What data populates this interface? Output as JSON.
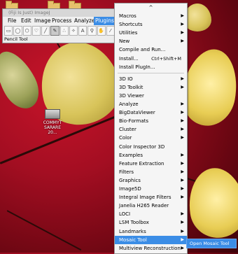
{
  "window": {
    "title": "(Fiji Is Just) ImageJ",
    "status": "Pencil Tool",
    "menubar": [
      "File",
      "Edit",
      "Image",
      "Process",
      "Analyze",
      "Plugins"
    ],
    "active_menu": "Plugins",
    "tool_icons": [
      "rectangle-icon",
      "oval-icon",
      "polygon-icon",
      "freehand-icon",
      "line-icon",
      "pencil-icon",
      "point-icon",
      "wand-icon",
      "text-icon",
      "magnifier-icon",
      "hand-icon",
      "dropper-icon",
      "more-icon"
    ]
  },
  "desktop_icon": {
    "label": "COMMYT SARARE 20..."
  },
  "plugins_menu": {
    "scroll_up": "^",
    "items": [
      {
        "label": "Macros",
        "arrow": true
      },
      {
        "label": "Shortcuts",
        "arrow": true
      },
      {
        "label": "Utilities",
        "arrow": true
      },
      {
        "label": "New",
        "arrow": true
      },
      {
        "label": "Compile and Run...",
        "arrow": false
      },
      {
        "label": "Install...",
        "shortcut": "Ctrl+Shift+M"
      },
      {
        "label": "Install PlugIn...",
        "arrow": false
      },
      {
        "sep": true
      },
      {
        "label": "3D IO",
        "arrow": true
      },
      {
        "label": "3D Toolkit",
        "arrow": true
      },
      {
        "label": "3D Viewer",
        "arrow": false
      },
      {
        "label": "Analyze",
        "arrow": true
      },
      {
        "label": "BigDataViewer",
        "arrow": true
      },
      {
        "label": "Bio-Formats",
        "arrow": true
      },
      {
        "label": "Cluster",
        "arrow": true
      },
      {
        "label": "Color",
        "arrow": true
      },
      {
        "label": "Color Inspector 3D",
        "arrow": false
      },
      {
        "label": "Examples",
        "arrow": true
      },
      {
        "label": "Feature Extraction",
        "arrow": true
      },
      {
        "label": "Filters",
        "arrow": true
      },
      {
        "label": "Graphics",
        "arrow": true
      },
      {
        "label": "Image5D",
        "arrow": true
      },
      {
        "label": "Integral Image Filters",
        "arrow": true
      },
      {
        "label": "Janelia H265 Reader",
        "arrow": false
      },
      {
        "label": "LOCI",
        "arrow": true
      },
      {
        "label": "LSM Toolbox",
        "arrow": true
      },
      {
        "label": "Landmarks",
        "arrow": true
      },
      {
        "label": "Mosaic Tool",
        "arrow": true,
        "highlight": true
      },
      {
        "label": "Multiview Reconstruction",
        "arrow": true
      }
    ]
  },
  "submenu": {
    "items": [
      "Open Mosaic Tool"
    ]
  },
  "colors": {
    "highlight": "#3b8de6"
  }
}
